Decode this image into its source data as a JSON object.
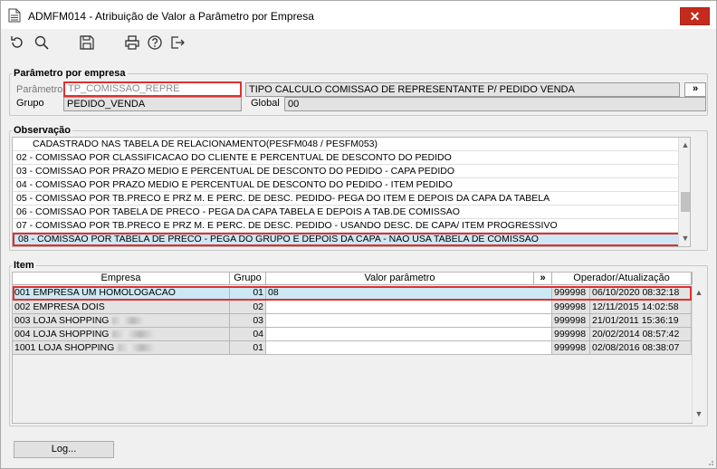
{
  "window": {
    "title": "ADMFM014 - Atribuição de Valor a Parâmetro por Empresa",
    "close_label": "✕"
  },
  "toolbar": {
    "icons": [
      "refresh-icon",
      "search-icon",
      "save-icon",
      "print-icon",
      "help-icon",
      "exit-icon"
    ]
  },
  "parametro": {
    "legend": "Parâmetro por empresa",
    "parametro_label": "Parâmetro",
    "parametro_value": "TP_COMISSAO_REPRE",
    "descricao_value": "TIPO CALCULO COMISSAO DE REPRESENTANTE P/ PEDIDO VENDA",
    "more_button": "»",
    "grupo_label": "Grupo",
    "grupo_value": "PEDIDO_VENDA",
    "global_label": "Global",
    "global_value": "00"
  },
  "observacao": {
    "legend": "Observação",
    "lines": [
      "CADASTRADO NAS TABELA DE RELACIONAMENTO(PESFM048 / PESFM053)",
      "02 - COMISSAO POR CLASSIFICACAO DO CLIENTE E PERCENTUAL DE DESCONTO DO PEDIDO",
      "03 - COMISSAO POR PRAZO MEDIO E PERCENTUAL DE DESCONTO DO PEDIDO - CAPA PEDIDO",
      "04 - COMISSAO POR PRAZO MEDIO E PERCENTUAL DE DESCONTO DO PEDIDO - ITEM PEDIDO",
      "05 - COMISSAO POR TB.PRECO E PRZ M. E PERC. DE DESC. PEDIDO- PEGA DO ITEM E DEPOIS DA CAPA DA TABELA",
      "06 - COMISSAO POR TABELA DE PRECO - PEGA DA CAPA TABELA E DEPOIS A TAB.DE COMISSAO",
      "07 - COMISSAO POR TB.PRECO E PRZ M. E PERC. DE DESC. PEDIDO - USANDO DESC. DE CAPA/ ITEM PROGRESSIVO",
      "08 - COMISSAO POR TABELA DE PRECO - PEGA DO GRUPO E DEPOIS DA CAPA - NAO USA TABELA DE COMISSAO"
    ]
  },
  "item": {
    "legend": "Item",
    "headers": {
      "empresa": "Empresa",
      "grupo": "Grupo",
      "valor": "Valor parâmetro",
      "more": "»",
      "operador": "Operador/Atualização"
    },
    "rows": [
      {
        "cod": "001",
        "nome": "EMPRESA UM HOMOLOGACAO",
        "grupo": "01",
        "valor": "08",
        "operador": "999998",
        "data": "06/10/2020 08:32:18",
        "blurred": false
      },
      {
        "cod": "002",
        "nome": "EMPRESA DOIS",
        "grupo": "02",
        "valor": "",
        "operador": "999998",
        "data": "12/11/2015 14:02:58",
        "blurred": false
      },
      {
        "cod": "003",
        "nome": "LOJA SHOPPING",
        "grupo": "03",
        "valor": "",
        "operador": "999998",
        "data": "21/01/2011 15:36:19",
        "blurred": true
      },
      {
        "cod": "004",
        "nome": "LOJA SHOPPING",
        "grupo": "04",
        "valor": "",
        "operador": "999998",
        "data": "20/02/2014 08:57:42",
        "blurred": true
      },
      {
        "cod": "1001",
        "nome": "LOJA SHOPPING",
        "grupo": "01",
        "valor": "",
        "operador": "999998",
        "data": "02/08/2016 08:38:07",
        "blurred": true
      }
    ]
  },
  "footer": {
    "log_button": "Log..."
  },
  "colors": {
    "selection_outline": "#e03030",
    "selection_fill": "#cce8f4",
    "close_button": "#c42b1c"
  }
}
